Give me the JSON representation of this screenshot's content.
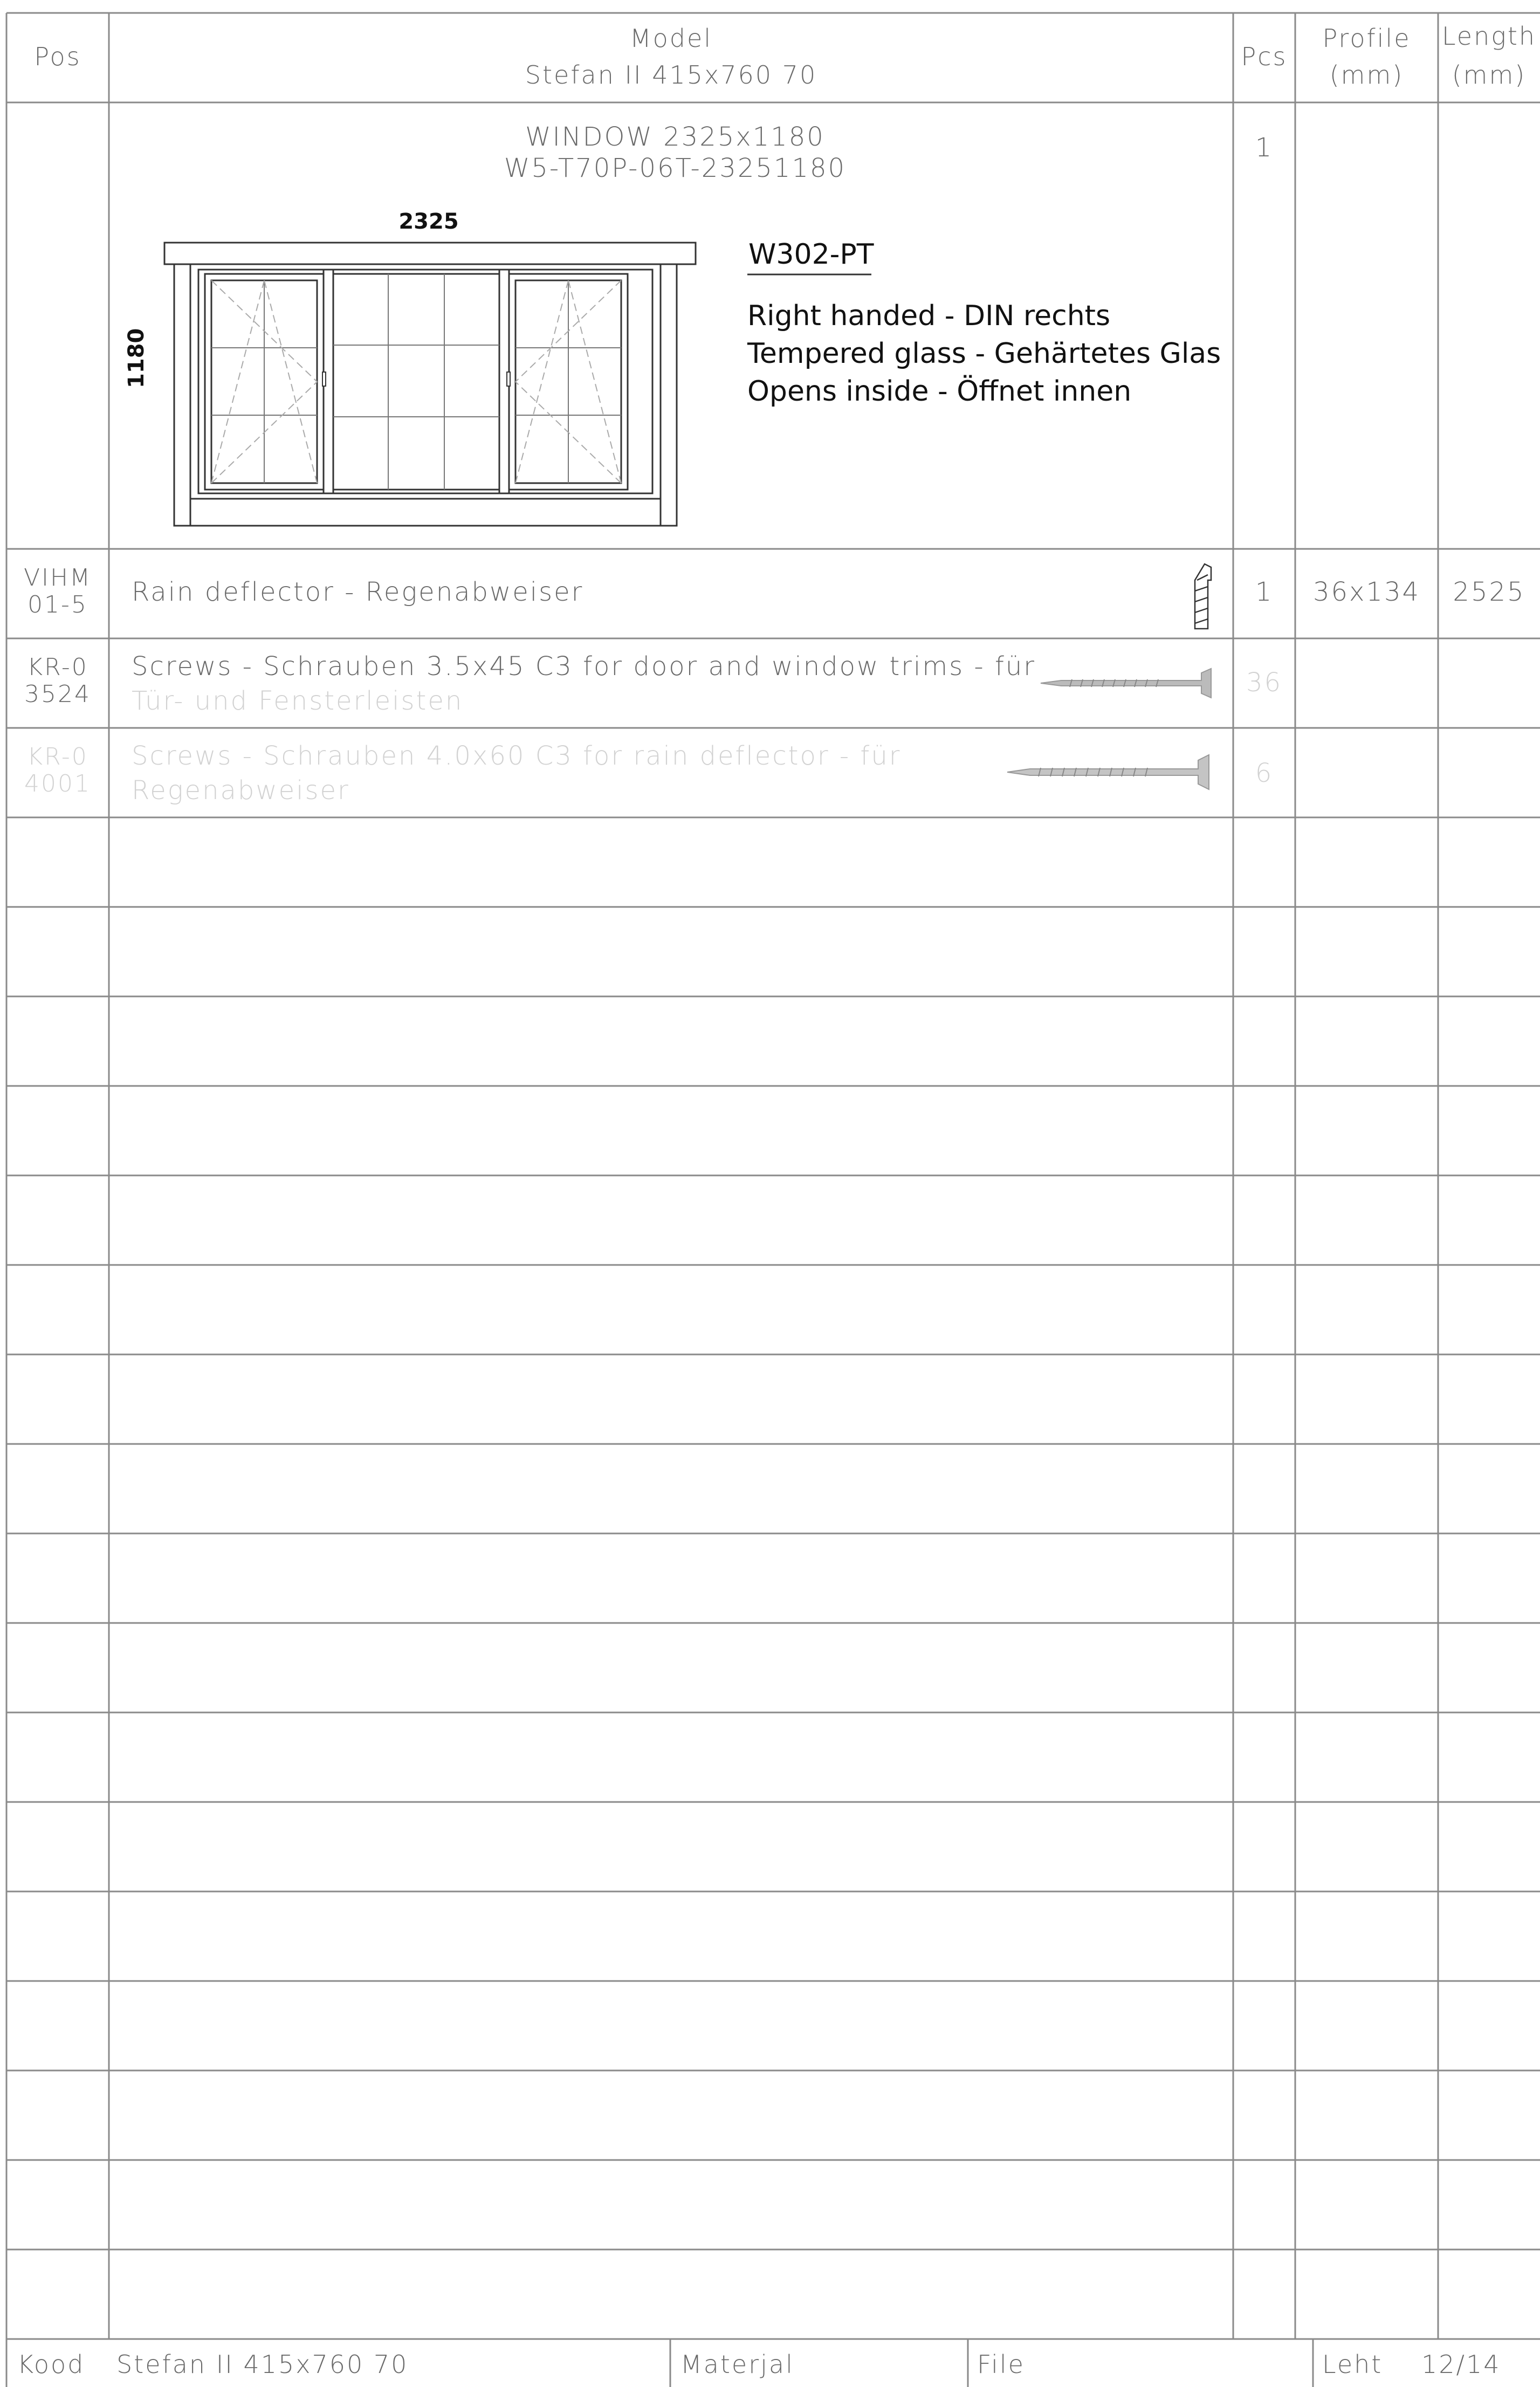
{
  "header": {
    "pos": "Pos",
    "model_label": "Model",
    "model_name": "Stefan II 415x760 70",
    "pcs": "Pcs",
    "profile_label": "Profile",
    "profile_unit": "(mm)",
    "length_label": "Length",
    "length_unit": "(mm)"
  },
  "window_item": {
    "title": "WINDOW 2325x1180",
    "code": "W5-T70P-06T-23251180",
    "pcs": "1",
    "width_label": "2325",
    "height_label": "1180",
    "model_code": "W302-PT",
    "notes": [
      "Right handed - DIN rechts",
      "Tempered glass - Gehärtetes Glas",
      "Opens inside - Öffnet innen"
    ]
  },
  "rows": [
    {
      "pos_line1": "VIHM",
      "pos_line2": "01-5",
      "desc_line1": "Rain deflector - Regenabweiser",
      "desc_line2": "",
      "pcs": "1",
      "profile": "36x134",
      "length": "2525",
      "icon": "profile-section-icon"
    },
    {
      "pos_line1": "KR-0",
      "pos_line2": "3524",
      "desc_line1": "Screws - Schrauben 3.5x45 C3   for door and window trims - für",
      "desc_line2": "Tür- und Fensterleisten",
      "pcs": "36",
      "profile": "",
      "length": "",
      "icon": "screw-icon"
    },
    {
      "pos_line1": "KR-0",
      "pos_line2": "4001",
      "desc_line1": "Screws - Schrauben 4.0x60 C3   for rain deflector - für",
      "desc_line2": "Regenabweiser",
      "pcs": "6",
      "profile": "",
      "length": "",
      "icon": "screw-icon"
    }
  ],
  "footer": {
    "kood_label": "Kood",
    "kood_value": "Stefan II 415x760 70",
    "material_label": "Materjal",
    "file_label": "File",
    "page_label": "Leht",
    "page_value": "12/14"
  }
}
